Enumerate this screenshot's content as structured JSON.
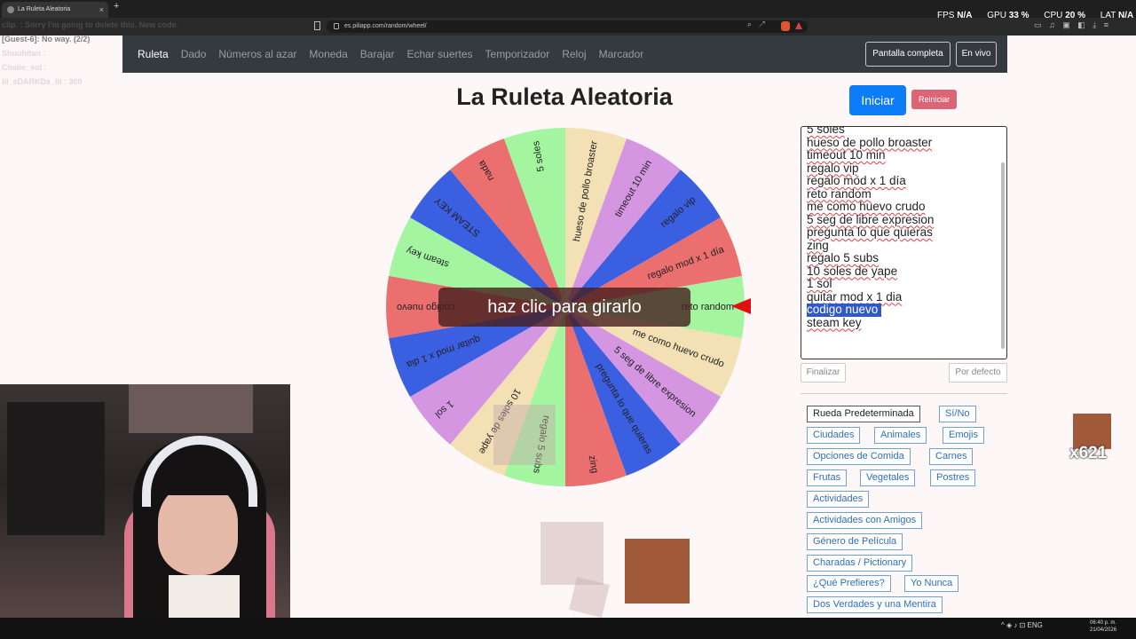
{
  "browser": {
    "tab_title": "La Ruleta Aleatoria",
    "tab_close": "×",
    "new_tab": "+",
    "url": "es.piliapp.com/random/wheel/"
  },
  "chat": {
    "lines": [
      "clip. : Sorry I'm going to delete this. New code.",
      "[Guest-6]: No way. (2/2)",
      "Shuuhitan : ",
      "Chalie_sol : ",
      "lil_sDARKDx_lil : 300"
    ]
  },
  "perf": {
    "fps_label": "FPS",
    "fps": "N/A",
    "gpu_label": "GPU",
    "gpu": "33 %",
    "cpu_label": "CPU",
    "cpu": "20 %",
    "lat_label": "LAT",
    "lat": "N/A"
  },
  "nav": {
    "links": [
      "Ruleta",
      "Dado",
      "Números al azar",
      "Moneda",
      "Barajar",
      "Echar suertes",
      "Temporizador",
      "Reloj",
      "Marcador"
    ],
    "fullscreen": "Pantalla completa",
    "live": "En vivo"
  },
  "page": {
    "title": "La Ruleta Aleatoria",
    "start": "Iniciar",
    "reset": "Reiniciar",
    "cta": "haz clic para girarlo"
  },
  "wheel": {
    "segments": [
      {
        "label": "reto random",
        "color": "#a3f59f"
      },
      {
        "label": "me como huevo crudo",
        "color": "#f3e0b4"
      },
      {
        "label": "5 seg de libre expresion",
        "color": "#d596e1"
      },
      {
        "label": "pregunta lo que quieras",
        "color": "#3b5fe1"
      },
      {
        "label": "zing",
        "color": "#ec6f70"
      },
      {
        "label": "regalo 5 subs",
        "color": "#a3f59f"
      },
      {
        "label": "10 soles de yape",
        "color": "#f3e0b4"
      },
      {
        "label": "1 sol",
        "color": "#d596e1"
      },
      {
        "label": "quitar mod x 1 dia",
        "color": "#3b5fe1"
      },
      {
        "label": "codigo nuevo",
        "color": "#ec6f70"
      },
      {
        "label": "steam key",
        "color": "#a3f59f"
      },
      {
        "label": "STEAM KEY",
        "color": "#3b5fe1"
      },
      {
        "label": "nada",
        "color": "#ec6f70"
      },
      {
        "label": "5 soles",
        "color": "#a3f59f"
      },
      {
        "label": "hueso de pollo broaster",
        "color": "#f3e0b4"
      },
      {
        "label": "timeout 10 min",
        "color": "#d596e1"
      },
      {
        "label": "regalo vip",
        "color": "#3b5fe1"
      },
      {
        "label": "regalo mod x 1 día",
        "color": "#ec6f70"
      }
    ]
  },
  "options_list": [
    "5 soles",
    "hueso de pollo broaster",
    "timeout 10 min",
    "regalo vip",
    "regalo mod x 1 día",
    "reto random",
    "me como huevo crudo",
    "5 seg de libre expresion",
    "pregunta lo que quieras",
    "zing",
    "regalo 5 subs",
    "10 soles de yape",
    "1 sol",
    "quitar mod x 1 dia",
    "codigo nuevo",
    "steam key"
  ],
  "selected_option": "codigo nuevo",
  "buttons": {
    "finalize": "Finalizar",
    "default": "Por defecto"
  },
  "presets": [
    "Rueda Predeterminada",
    "Sí/No",
    "Ciudades",
    "Animales",
    "Emojis",
    "Opciones de Comida",
    "Carnes",
    "Frutas",
    "Vegetales",
    "Postres",
    "Actividades",
    "Actividades con Amigos",
    "Género de Película",
    "Charadas / Pictionary",
    "¿Qué Prefieres?",
    "Yo Nunca",
    "Dos Verdades y una Mentira"
  ],
  "overlay": {
    "counter": "x621"
  },
  "taskbar": {
    "lang": "ENG",
    "time": "06:40 p. m.",
    "date": "21/04/2026"
  },
  "colors": {
    "navbar": "#343a40",
    "primary": "#0d7df7",
    "danger": "#dc6475",
    "pointer": "#e01010",
    "selection": "#2f58c8"
  }
}
